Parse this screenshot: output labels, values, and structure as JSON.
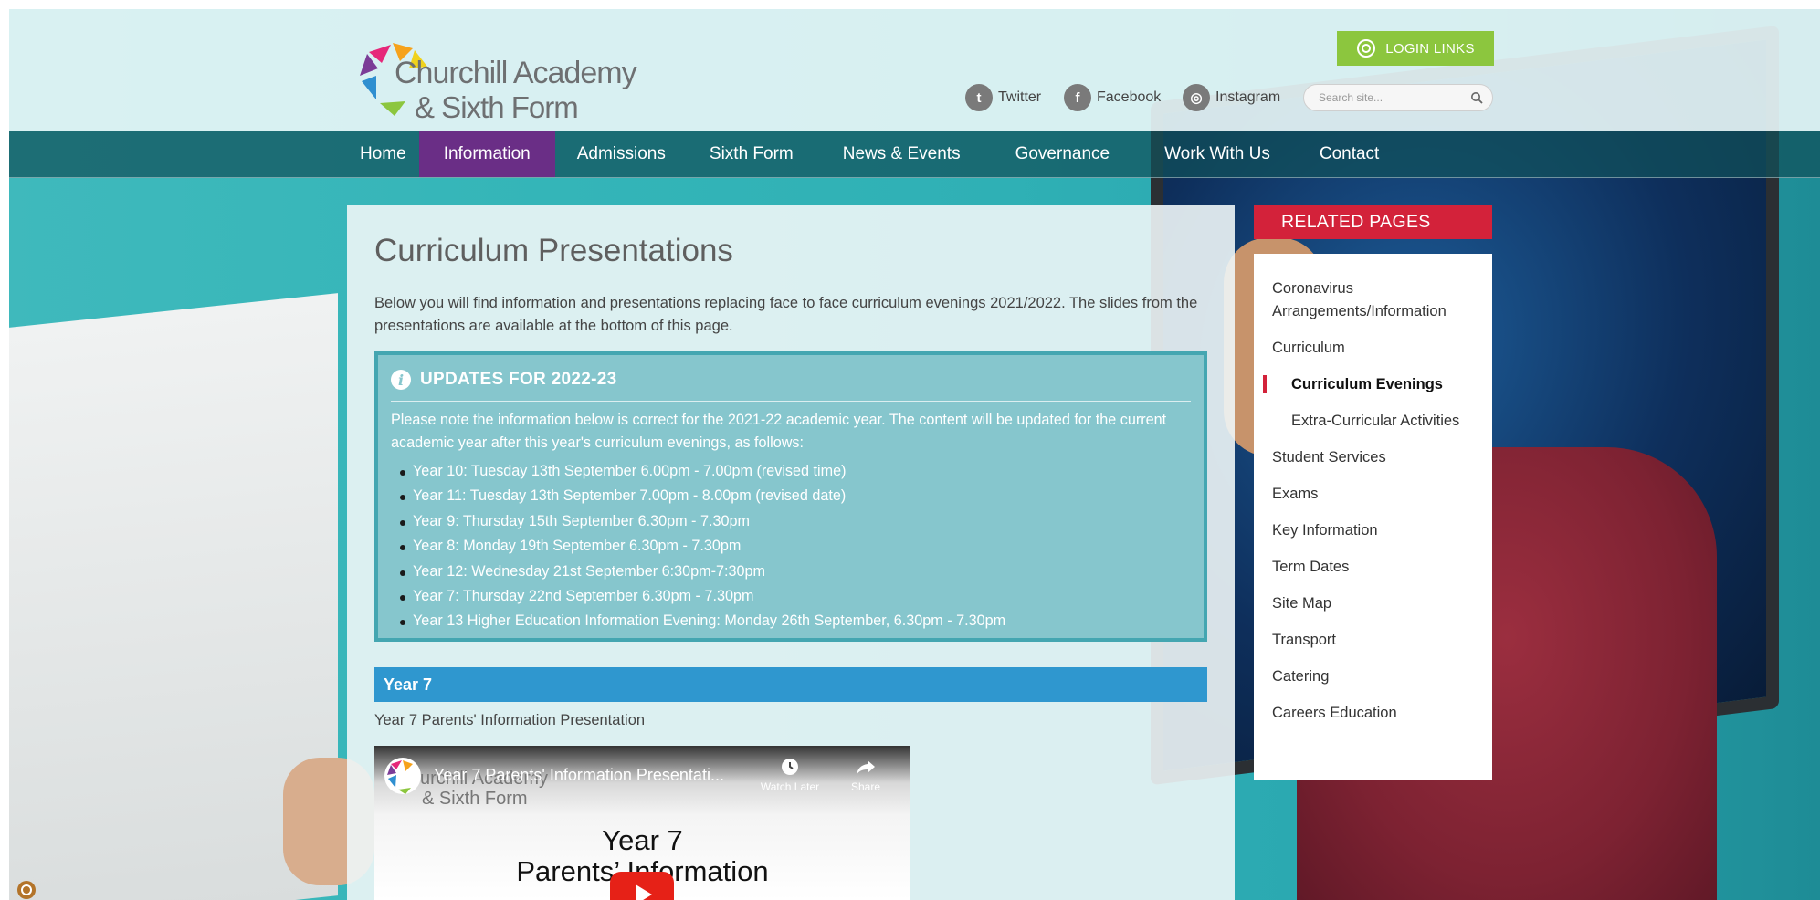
{
  "site": {
    "logo_line1": "Churchill Academy",
    "logo_line2": "& Sixth Form",
    "login_label": "LOGIN LINKS",
    "social": [
      {
        "label": "Twitter",
        "icon": "twitter-icon"
      },
      {
        "label": "Facebook",
        "icon": "facebook-icon"
      },
      {
        "label": "Instagram",
        "icon": "instagram-icon"
      }
    ],
    "search_placeholder": "Search site..."
  },
  "nav": {
    "items": [
      "Home",
      "Information",
      "Admissions",
      "Sixth Form",
      "News & Events",
      "Governance",
      "Work With Us",
      "Contact"
    ],
    "active": "Information"
  },
  "main": {
    "title": "Curriculum Presentations",
    "intro": "Below you will find information and presentations replacing face to face curriculum evenings 2021/2022. The slides from the presentations are available at the bottom of this page.",
    "updates": {
      "title": "UPDATES FOR 2022-23",
      "note": "Please note the information below is correct for the 2021-22 academic year. The content will be updated for the current academic year after this year's curriculum evenings, as follows:",
      "items": [
        "Year 10: Tuesday 13th September 6.00pm - 7.00pm (revised time)",
        "Year 11: Tuesday 13th September 7.00pm - 8.00pm (revised date)",
        "Year 9: Thursday 15th September 6.30pm - 7.30pm",
        "Year 8: Monday 19th September 6.30pm - 7.30pm",
        "Year 12: Wednesday 21st September 6:30pm-7:30pm",
        "Year 7: Thursday 22nd September 6.30pm - 7.30pm",
        "Year 13 Higher Education Information Evening: Monday 26th September, 6.30pm - 7.30pm"
      ]
    },
    "year_section": "Year 7",
    "video_caption": "Year 7 Parents' Information Presentation",
    "video": {
      "title": "Year 7 Parents' Information Presentati...",
      "channel_line1": "urchill Academy",
      "channel_line2": "& Sixth Form",
      "watch_later": "Watch Later",
      "share": "Share",
      "slide_line1": "Year 7",
      "slide_line2": "Parents’ Information"
    }
  },
  "sidebar": {
    "heading": "RELATED PAGES",
    "items": [
      {
        "label": "Coronavirus Arrangements/Information",
        "level": 0
      },
      {
        "label": "Curriculum",
        "level": 0
      },
      {
        "label": "Curriculum Evenings",
        "level": 1,
        "current": true
      },
      {
        "label": "Extra-Curricular Activities",
        "level": 1
      },
      {
        "label": "Student Services",
        "level": 0
      },
      {
        "label": "Exams",
        "level": 0
      },
      {
        "label": "Key Information",
        "level": 0
      },
      {
        "label": "Term Dates",
        "level": 0
      },
      {
        "label": "Site Map",
        "level": 0
      },
      {
        "label": "Transport",
        "level": 0
      },
      {
        "label": "Catering",
        "level": 0
      },
      {
        "label": "Careers Education",
        "level": 0
      }
    ]
  },
  "colors": {
    "nav_active": "#6a2e86",
    "login_green": "#8cc63e",
    "related_red": "#d3223a",
    "updates_bg": "#86c6cd",
    "year_bar": "#2f97cf"
  }
}
